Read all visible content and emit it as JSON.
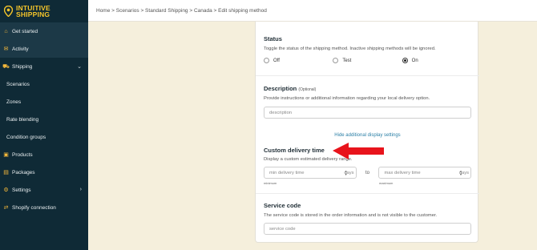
{
  "brand": {
    "line1": "INTUITIVE",
    "line2": "SHIPPING"
  },
  "sidebar": {
    "items": [
      {
        "label": "Get started",
        "icon": "home-icon"
      },
      {
        "label": "Activity",
        "icon": "activity-icon"
      },
      {
        "label": "Shipping",
        "icon": "truck-icon"
      },
      {
        "label": "Scenarios"
      },
      {
        "label": "Zones"
      },
      {
        "label": "Rate blending"
      },
      {
        "label": "Condition groups"
      },
      {
        "label": "Products",
        "icon": "box-icon"
      },
      {
        "label": "Packages",
        "icon": "package-icon"
      },
      {
        "label": "Settings",
        "icon": "gear-icon"
      },
      {
        "label": "Shopify connection",
        "icon": "connection-icon"
      }
    ]
  },
  "breadcrumb": "Home > Scenarios > Standard Shipping > Canada > Edit shipping method",
  "status": {
    "title": "Status",
    "description": "Toggle the status of the shipping method. Inactive shipping methods will be ignored.",
    "options": [
      "Off",
      "Test",
      "On"
    ],
    "selected": "On"
  },
  "description_section": {
    "title": "Description",
    "optional": "(Optional)",
    "help": "Provide instructions or additional information regarding your local delivery option.",
    "placeholder": "description"
  },
  "hide_display_link": "Hide additional display settings",
  "delivery_time": {
    "title": "Custom delivery time",
    "help": "Display a custom estimated delivery range.",
    "min_placeholder": "min delivery time",
    "max_placeholder": "max delivery time",
    "unit": "days",
    "to": "to",
    "min_label": "minimum",
    "max_label": "maximum"
  },
  "service_code": {
    "title": "Service code",
    "help": "The service code is stored in the order information and is not visible to the customer.",
    "placeholder": "service code"
  },
  "colors": {
    "accent": "#f6c62a",
    "sidebar": "#0f2a36",
    "link": "#2a7fa6",
    "arrow": "#e8141c"
  }
}
